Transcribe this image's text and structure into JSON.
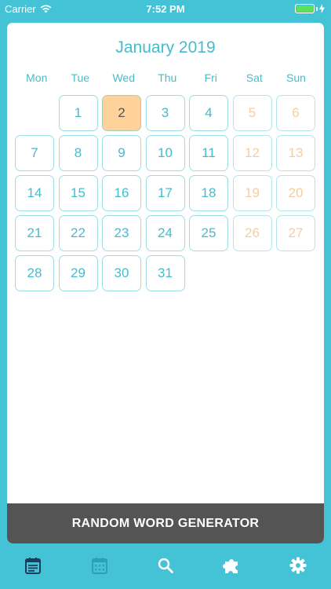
{
  "status_bar": {
    "carrier": "Carrier",
    "time": "7:52 PM"
  },
  "calendar": {
    "month_title": "January 2019",
    "weekdays": [
      "Mon",
      "Tue",
      "Wed",
      "Thu",
      "Fri",
      "Sat",
      "Sun"
    ],
    "leading_blanks": 1,
    "days_in_month": 31,
    "selected_day": 2,
    "days": [
      "1",
      "2",
      "3",
      "4",
      "5",
      "6",
      "7",
      "8",
      "9",
      "10",
      "11",
      "12",
      "13",
      "14",
      "15",
      "16",
      "17",
      "18",
      "19",
      "20",
      "21",
      "22",
      "23",
      "24",
      "25",
      "26",
      "27",
      "28",
      "29",
      "30",
      "31"
    ]
  },
  "generator_button": {
    "label": "RANDOM WORD GENERATOR"
  },
  "tab_bar": {
    "items": [
      {
        "icon": "notes-icon",
        "active": true
      },
      {
        "icon": "calendar-icon",
        "active": false
      },
      {
        "icon": "search-icon",
        "active": false
      },
      {
        "icon": "puzzle-icon",
        "active": false
      },
      {
        "icon": "gear-icon",
        "active": false
      }
    ]
  },
  "colors": {
    "background": "#45c3d6",
    "accent": "#45bccd",
    "weekend": "#f7cda0",
    "selected": "#ffd29c",
    "button": "#545454",
    "tab_inactive": "#2f9fb2"
  }
}
